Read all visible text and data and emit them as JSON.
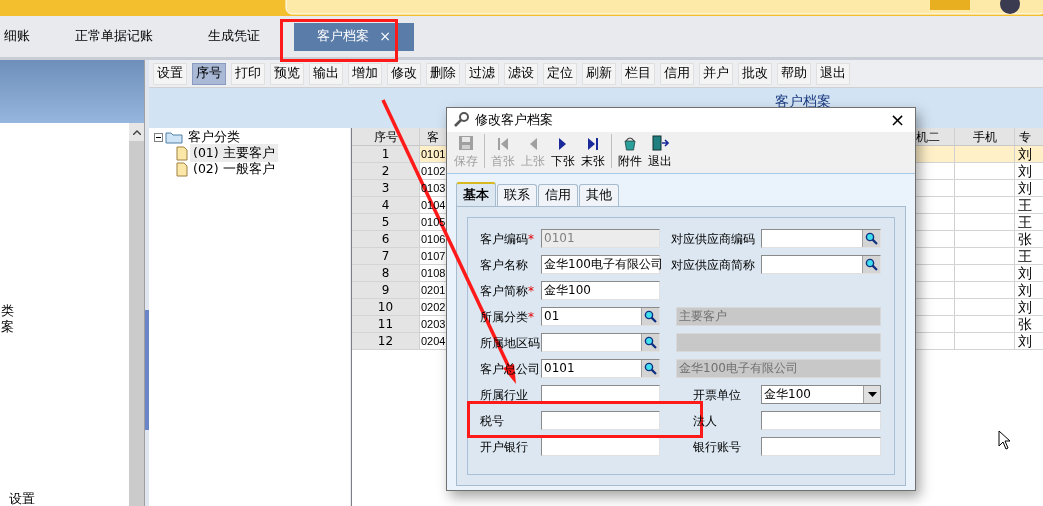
{
  "tabs": [
    {
      "label": "细账",
      "selected": false
    },
    {
      "label": "正常单据记账",
      "selected": false
    },
    {
      "label": "生成凭证",
      "selected": false
    },
    {
      "label": "客户档案",
      "selected": true,
      "close": "×"
    }
  ],
  "left_panel": {
    "items": [
      "类",
      "案"
    ],
    "footer": "设置"
  },
  "toolbar": [
    {
      "label": "设置",
      "selected": false
    },
    {
      "label": "序号",
      "selected": true
    },
    {
      "label": "打印",
      "selected": false
    },
    {
      "label": "预览",
      "selected": false
    },
    {
      "label": "输出",
      "selected": false
    },
    {
      "label": "增加",
      "selected": false
    },
    {
      "label": "修改",
      "selected": false
    },
    {
      "label": "删除",
      "selected": false
    },
    {
      "label": "过滤",
      "selected": false
    },
    {
      "label": "滤设",
      "selected": false
    },
    {
      "label": "定位",
      "selected": false
    },
    {
      "label": "刷新",
      "selected": false
    },
    {
      "label": "栏目",
      "selected": false
    },
    {
      "label": "信用",
      "selected": false
    },
    {
      "label": "并户",
      "selected": false
    },
    {
      "label": "批改",
      "selected": false
    },
    {
      "label": "帮助",
      "selected": false
    },
    {
      "label": "退出",
      "selected": false
    }
  ],
  "page_title": "客户档案",
  "tree": [
    {
      "label": "客户分类",
      "expanded": true,
      "selected": false,
      "children": [
        {
          "label": "(01) 主要客户",
          "selected": true
        },
        {
          "label": "(02) 一般客户",
          "selected": false
        }
      ]
    }
  ],
  "table": {
    "columns": [
      "序号",
      "客",
      "机二",
      "手机",
      "专"
    ],
    "rows": [
      {
        "no": "1",
        "code": "0101",
        "person": "刘",
        "selected": true
      },
      {
        "no": "2",
        "code": "0102",
        "person": "刘",
        "selected": false
      },
      {
        "no": "3",
        "code": "0103",
        "person": "刘",
        "selected": false
      },
      {
        "no": "4",
        "code": "0104",
        "person": "王",
        "selected": false
      },
      {
        "no": "5",
        "code": "0105",
        "person": "王",
        "selected": false
      },
      {
        "no": "6",
        "code": "0106",
        "person": "张",
        "selected": false
      },
      {
        "no": "7",
        "code": "0107",
        "person": "王",
        "selected": false
      },
      {
        "no": "8",
        "code": "0108",
        "person": "刘",
        "selected": false
      },
      {
        "no": "9",
        "code": "0201",
        "person": "刘",
        "selected": false
      },
      {
        "no": "10",
        "code": "0202",
        "person": "刘",
        "selected": false
      },
      {
        "no": "11",
        "code": "0203",
        "person": "张",
        "selected": false
      },
      {
        "no": "12",
        "code": "0204",
        "person": "刘",
        "selected": false
      }
    ]
  },
  "dialog": {
    "title": "修改客户档案",
    "close": "×",
    "toolbar": [
      {
        "kind": "save",
        "label": "保存",
        "disabled": true
      },
      {
        "kind": "first",
        "label": "首张",
        "disabled": true
      },
      {
        "kind": "prev",
        "label": "上张",
        "disabled": true
      },
      {
        "kind": "next",
        "label": "下张",
        "disabled": false
      },
      {
        "kind": "last",
        "label": "末张",
        "disabled": false
      },
      {
        "kind": "attach",
        "label": "附件",
        "disabled": false
      },
      {
        "kind": "exit",
        "label": "退出",
        "disabled": false
      }
    ],
    "tabs": [
      {
        "label": "基本",
        "selected": true
      },
      {
        "label": "联系",
        "selected": false
      },
      {
        "label": "信用",
        "selected": false
      },
      {
        "label": "其他",
        "selected": false
      }
    ],
    "rows": [
      {
        "left": {
          "label": "客户编码",
          "required_mark": "*",
          "kind": "text",
          "value": "0101",
          "disabled": true
        },
        "right": {
          "label": "对应供应商编码",
          "kind": "lookup"
        }
      },
      {
        "left": {
          "label": "客户名称",
          "kind": "text",
          "value": "金华100电子有限公司",
          "disabled": false
        },
        "right": {
          "label": "对应供应商简称",
          "kind": "lookup"
        }
      },
      {
        "left": {
          "label": "客户简称",
          "required_mark": "*",
          "kind": "text",
          "value": "金华100",
          "disabled": false
        }
      },
      {
        "left": {
          "label": "所属分类",
          "required_mark": "*",
          "kind": "lookup",
          "value": "01",
          "disabled": false
        },
        "right": {
          "kind": "display",
          "value": "主要客户"
        }
      },
      {
        "left": {
          "label": "所属地区码",
          "kind": "lookup",
          "disabled": false
        },
        "right": {
          "kind": "display"
        }
      },
      {
        "left": {
          "label": "客户总公司",
          "kind": "lookup",
          "value": "0101",
          "disabled": false
        },
        "right": {
          "kind": "display",
          "value": "金华100电子有限公司"
        }
      },
      {
        "left": {
          "label": "所属行业",
          "kind": "text",
          "disabled": false
        },
        "right": {
          "label": "开票单位",
          "kind": "select",
          "value": "金华100"
        }
      },
      {
        "left": {
          "label": "税号",
          "kind": "text",
          "disabled": false
        },
        "right": {
          "label": "法人",
          "kind": "text"
        }
      },
      {
        "left": {
          "label": "开户银行",
          "kind": "text",
          "disabled": false
        },
        "right": {
          "label": "银行账号",
          "kind": "text"
        }
      }
    ]
  }
}
